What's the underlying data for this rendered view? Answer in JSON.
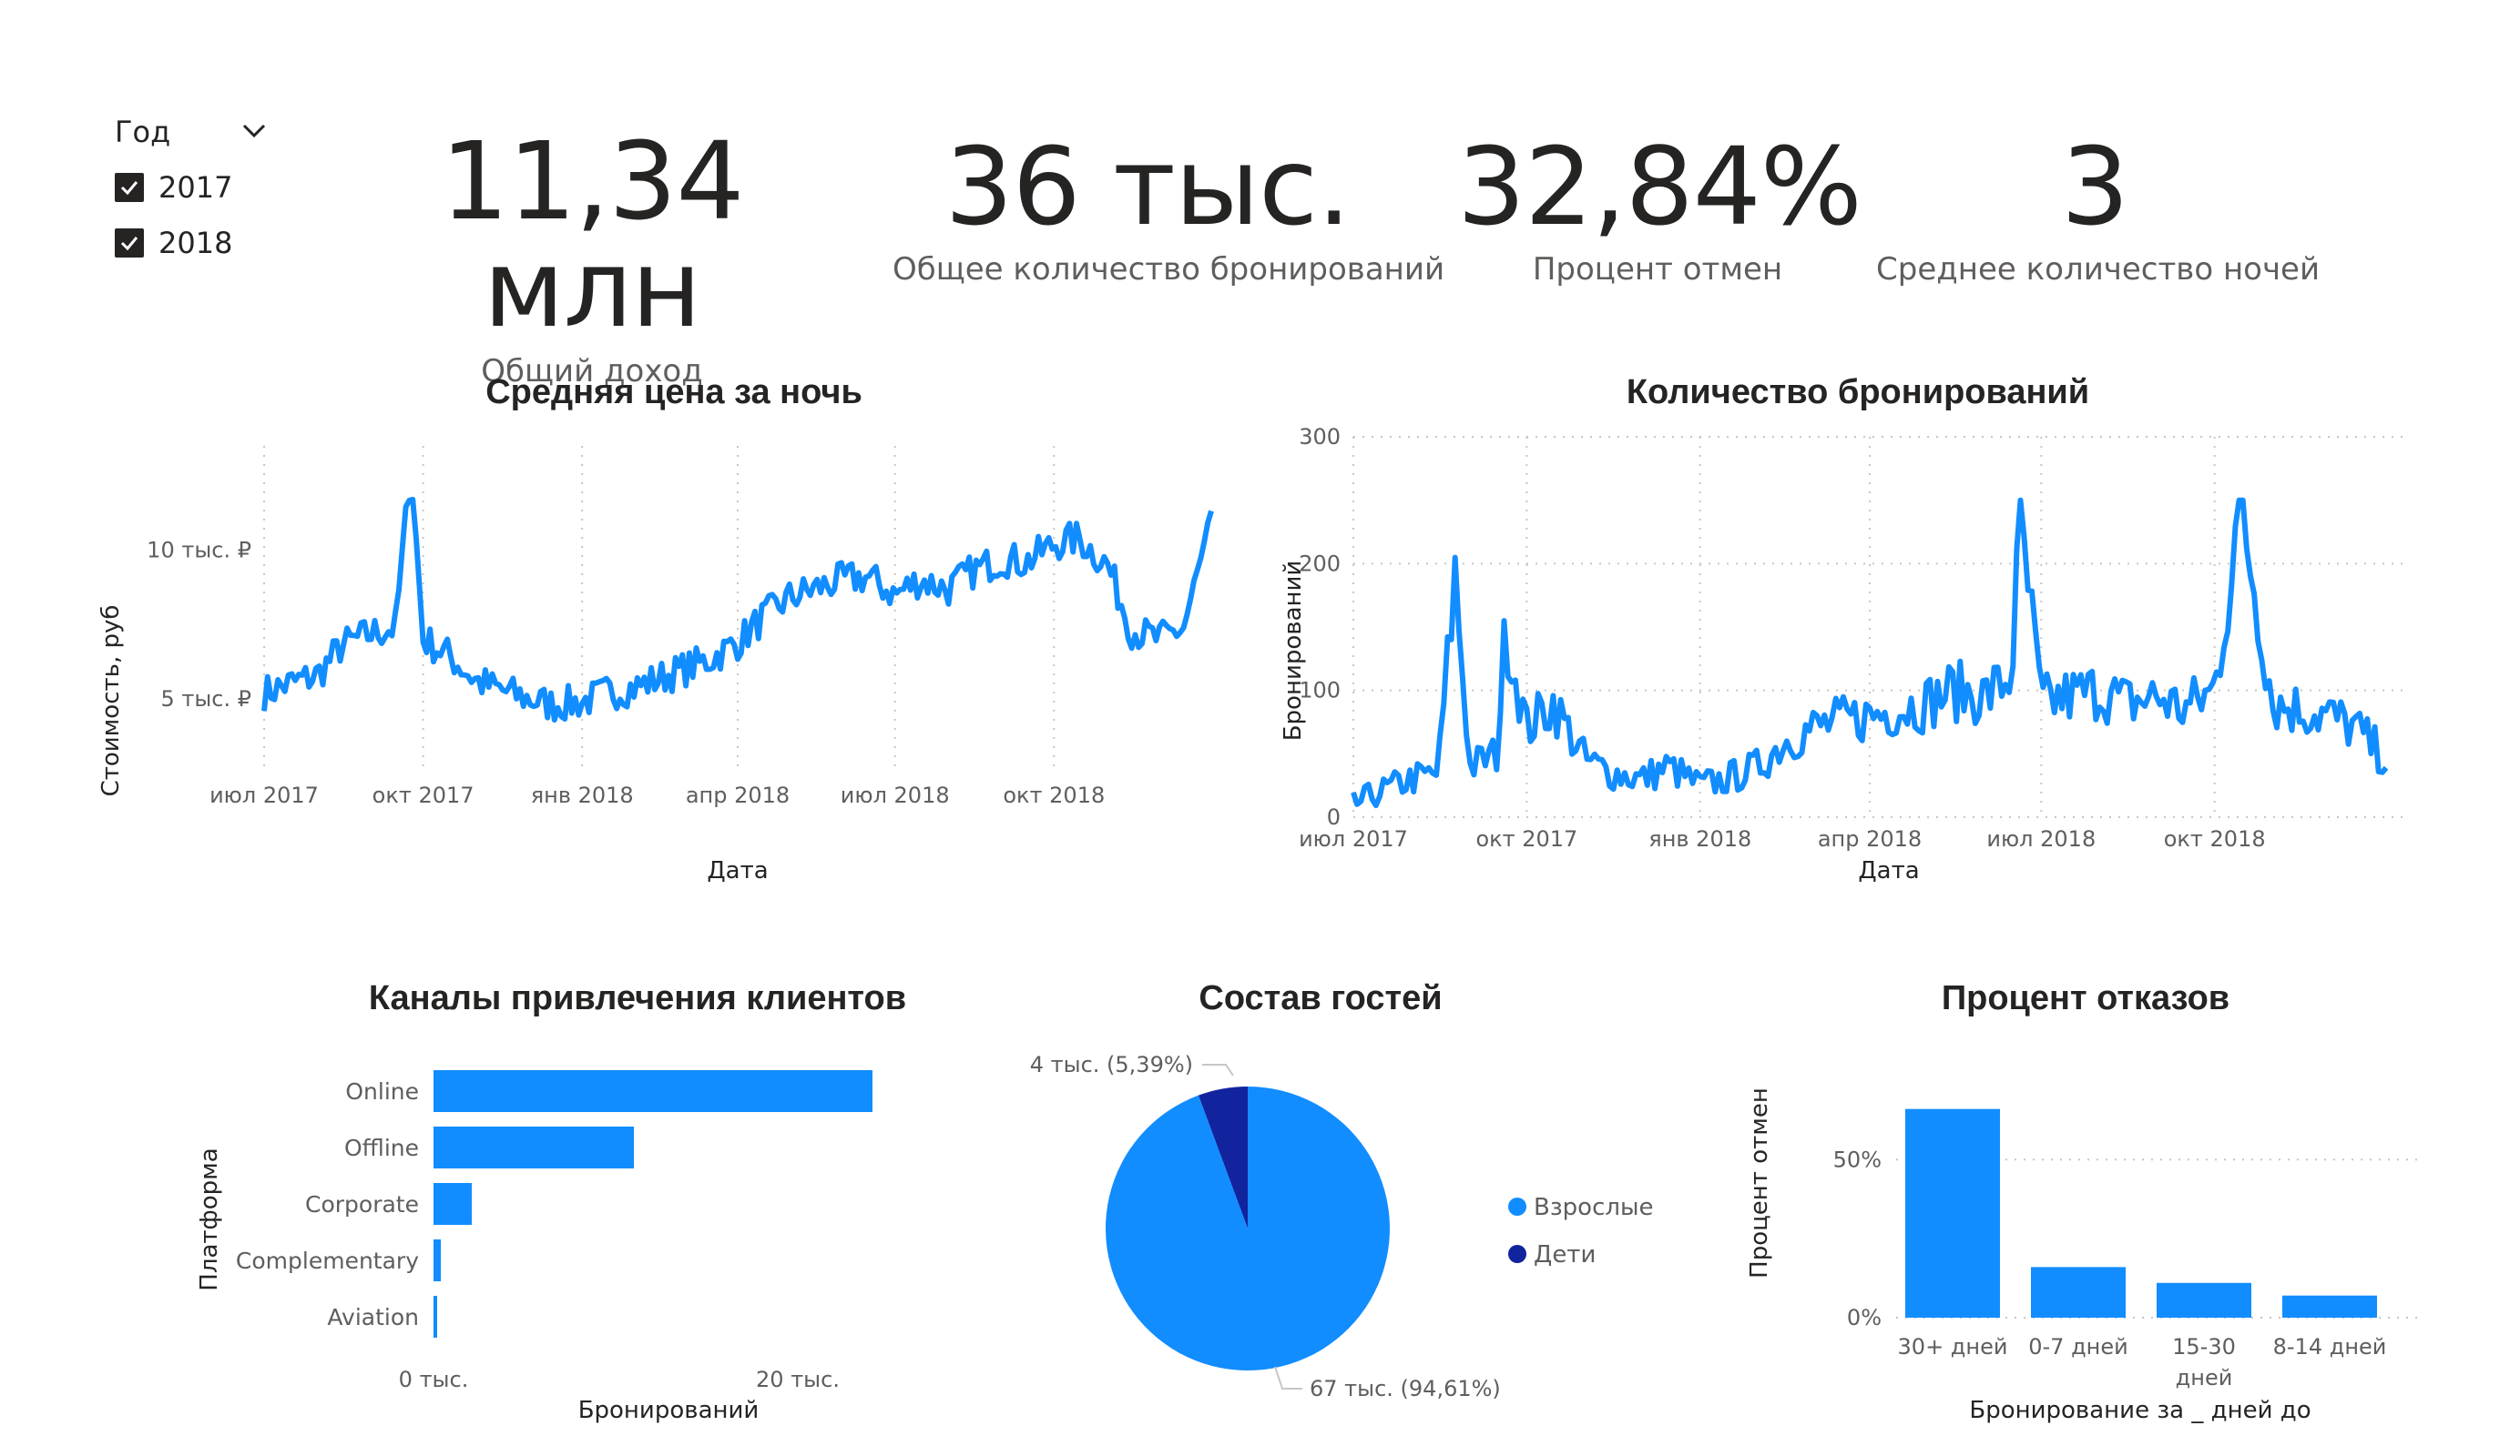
{
  "slicer": {
    "title": "Год",
    "items": [
      "2017",
      "2018"
    ]
  },
  "cards": [
    {
      "value": "11,34 млн",
      "label": "Общий доход"
    },
    {
      "value": "36 тыс.",
      "label": "Общее количество бронирований"
    },
    {
      "value": "32,84%",
      "label": "Процент отмен"
    },
    {
      "value": "3",
      "label": "Среднее количество ночей"
    }
  ],
  "colors": {
    "accent": "#118dff",
    "dark_blue": "#12239e",
    "text": "#252423",
    "muted": "#605e5c",
    "grid": "#c8c6c4"
  },
  "chart_data": [
    {
      "type": "line",
      "title": "Средняя цена за ночь",
      "xlabel": "Дата",
      "ylabel": "Стоимость, руб",
      "x_ticks": [
        "июл 2017",
        "окт 2017",
        "янв 2018",
        "апр 2018",
        "июл 2018",
        "окт 2018"
      ],
      "y_ticks": [
        {
          "value": 5000,
          "label": "5 тыс. ₽"
        },
        {
          "value": 10000,
          "label": "10 тыс. ₽"
        }
      ],
      "xlim": [
        "2017-07-01",
        "2018-12-31"
      ],
      "ylim": [
        2500,
        13500
      ],
      "x": [
        "2017-07-01",
        "2017-07-15",
        "2017-08-01",
        "2017-08-15",
        "2017-09-01",
        "2017-09-15",
        "2017-09-24",
        "2017-10-01",
        "2017-10-15",
        "2017-11-01",
        "2017-11-15",
        "2017-12-01",
        "2017-12-15",
        "2018-01-01",
        "2018-01-15",
        "2018-02-01",
        "2018-02-15",
        "2018-03-01",
        "2018-03-15",
        "2018-04-01",
        "2018-04-15",
        "2018-05-01",
        "2018-05-15",
        "2018-06-01",
        "2018-06-15",
        "2018-07-01",
        "2018-07-15",
        "2018-08-01",
        "2018-08-15",
        "2018-09-01",
        "2018-09-15",
        "2018-10-01",
        "2018-10-15",
        "2018-11-01",
        "2018-11-15",
        "2018-12-01",
        "2018-12-15",
        "2018-12-31"
      ],
      "values": [
        5200,
        5500,
        5800,
        6800,
        7200,
        7400,
        12800,
        7000,
        6500,
        5600,
        5300,
        5000,
        4800,
        4900,
        5200,
        5400,
        5700,
        6000,
        6300,
        6900,
        7700,
        8400,
        8700,
        9000,
        9100,
        8500,
        9000,
        8700,
        9300,
        9700,
        9600,
        10200,
        10400,
        9500,
        7300,
        7000,
        7400,
        10900
      ]
    },
    {
      "type": "line",
      "title": "Количество бронирований",
      "xlabel": "Дата",
      "ylabel": "Бронирований",
      "x_ticks": [
        "июл 2017",
        "окт 2017",
        "янв 2018",
        "апр 2018",
        "июл 2018",
        "окт 2018"
      ],
      "y_ticks": [
        0,
        100,
        200,
        300
      ],
      "xlim": [
        "2017-07-01",
        "2018-12-31"
      ],
      "ylim": [
        0,
        300
      ],
      "x": [
        "2017-07-01",
        "2017-07-15",
        "2017-08-01",
        "2017-08-15",
        "2017-08-24",
        "2017-09-01",
        "2017-09-15",
        "2017-09-20",
        "2017-10-01",
        "2017-10-15",
        "2017-11-01",
        "2017-11-15",
        "2017-12-01",
        "2017-12-15",
        "2018-01-01",
        "2018-01-15",
        "2018-02-01",
        "2018-02-15",
        "2018-03-01",
        "2018-03-15",
        "2018-04-01",
        "2018-04-15",
        "2018-05-01",
        "2018-05-15",
        "2018-06-01",
        "2018-06-15",
        "2018-06-20",
        "2018-07-01",
        "2018-07-15",
        "2018-08-01",
        "2018-08-15",
        "2018-09-01",
        "2018-09-15",
        "2018-10-01",
        "2018-10-15",
        "2018-11-01",
        "2018-11-15",
        "2018-12-01",
        "2018-12-15",
        "2018-12-31"
      ],
      "values": [
        10,
        20,
        30,
        35,
        190,
        40,
        50,
        150,
        70,
        90,
        45,
        35,
        30,
        40,
        25,
        30,
        40,
        60,
        70,
        75,
        80,
        85,
        90,
        100,
        95,
        110,
        230,
        90,
        95,
        100,
        90,
        95,
        85,
        100,
        250,
        90,
        85,
        80,
        70,
        45
      ]
    },
    {
      "type": "bar",
      "orientation": "horizontal",
      "title": "Каналы привлечения клиентов",
      "xlabel": "Бронирований",
      "ylabel": "Платформа",
      "categories": [
        "Online",
        "Offline",
        "Corporate",
        "Complementary",
        "Aviation"
      ],
      "values": [
        24100,
        11000,
        2100,
        400,
        200
      ],
      "x_ticks": [
        {
          "value": 0,
          "label": "0 тыс."
        },
        {
          "value": 20000,
          "label": "20 тыс."
        }
      ],
      "xlim": [
        0,
        30000
      ]
    },
    {
      "type": "pie",
      "title": "Состав гостей",
      "series": [
        {
          "name": "Взрослые",
          "value": 67000,
          "label": "67 тыс. (94,61%)",
          "color": "#118dff"
        },
        {
          "name": "Дети",
          "value": 4000,
          "label": "4 тыс. (5,39%)",
          "color": "#12239e"
        }
      ],
      "legend": "right"
    },
    {
      "type": "bar",
      "title": "Процент отказов",
      "xlabel": "Бронирование за _ дней до",
      "ylabel": "Процент отмен",
      "categories": [
        "30+ дней",
        "0-7 дней",
        "15-30 дней",
        "8-14 дней"
      ],
      "values": [
        66,
        16,
        11,
        7
      ],
      "y_ticks": [
        {
          "value": 0,
          "label": "0%"
        },
        {
          "value": 50,
          "label": "50%"
        }
      ],
      "ylim": [
        0,
        80
      ]
    }
  ]
}
